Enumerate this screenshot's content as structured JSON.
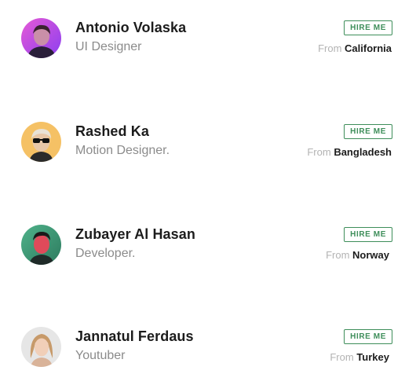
{
  "people": [
    {
      "name": "Antonio Volaska",
      "role": "UI Designer",
      "hire_label": "HIRE ME",
      "from_label": "From",
      "location": "California",
      "avatar_icon": "avatar-purple-portrait"
    },
    {
      "name": "Rashed Ka",
      "role": "Motion Designer.",
      "hire_label": "HIRE ME",
      "from_label": "From",
      "location": "Bangladesh",
      "avatar_icon": "avatar-sunglasses-portrait"
    },
    {
      "name": "Zubayer Al Hasan",
      "role": "Developer.",
      "hire_label": "HIRE ME",
      "from_label": "From",
      "location": "Norway",
      "avatar_icon": "avatar-green-portrait"
    },
    {
      "name": "Jannatul Ferdaus",
      "role": "Youtuber",
      "hire_label": "HIRE ME",
      "from_label": "From",
      "location": "Turkey",
      "avatar_icon": "avatar-blonde-portrait"
    }
  ],
  "colors": {
    "accent_green": "#3e8e5a",
    "name_text": "#1c1c1c",
    "role_text": "#8b8b8b",
    "from_text": "#b3b3b3"
  }
}
